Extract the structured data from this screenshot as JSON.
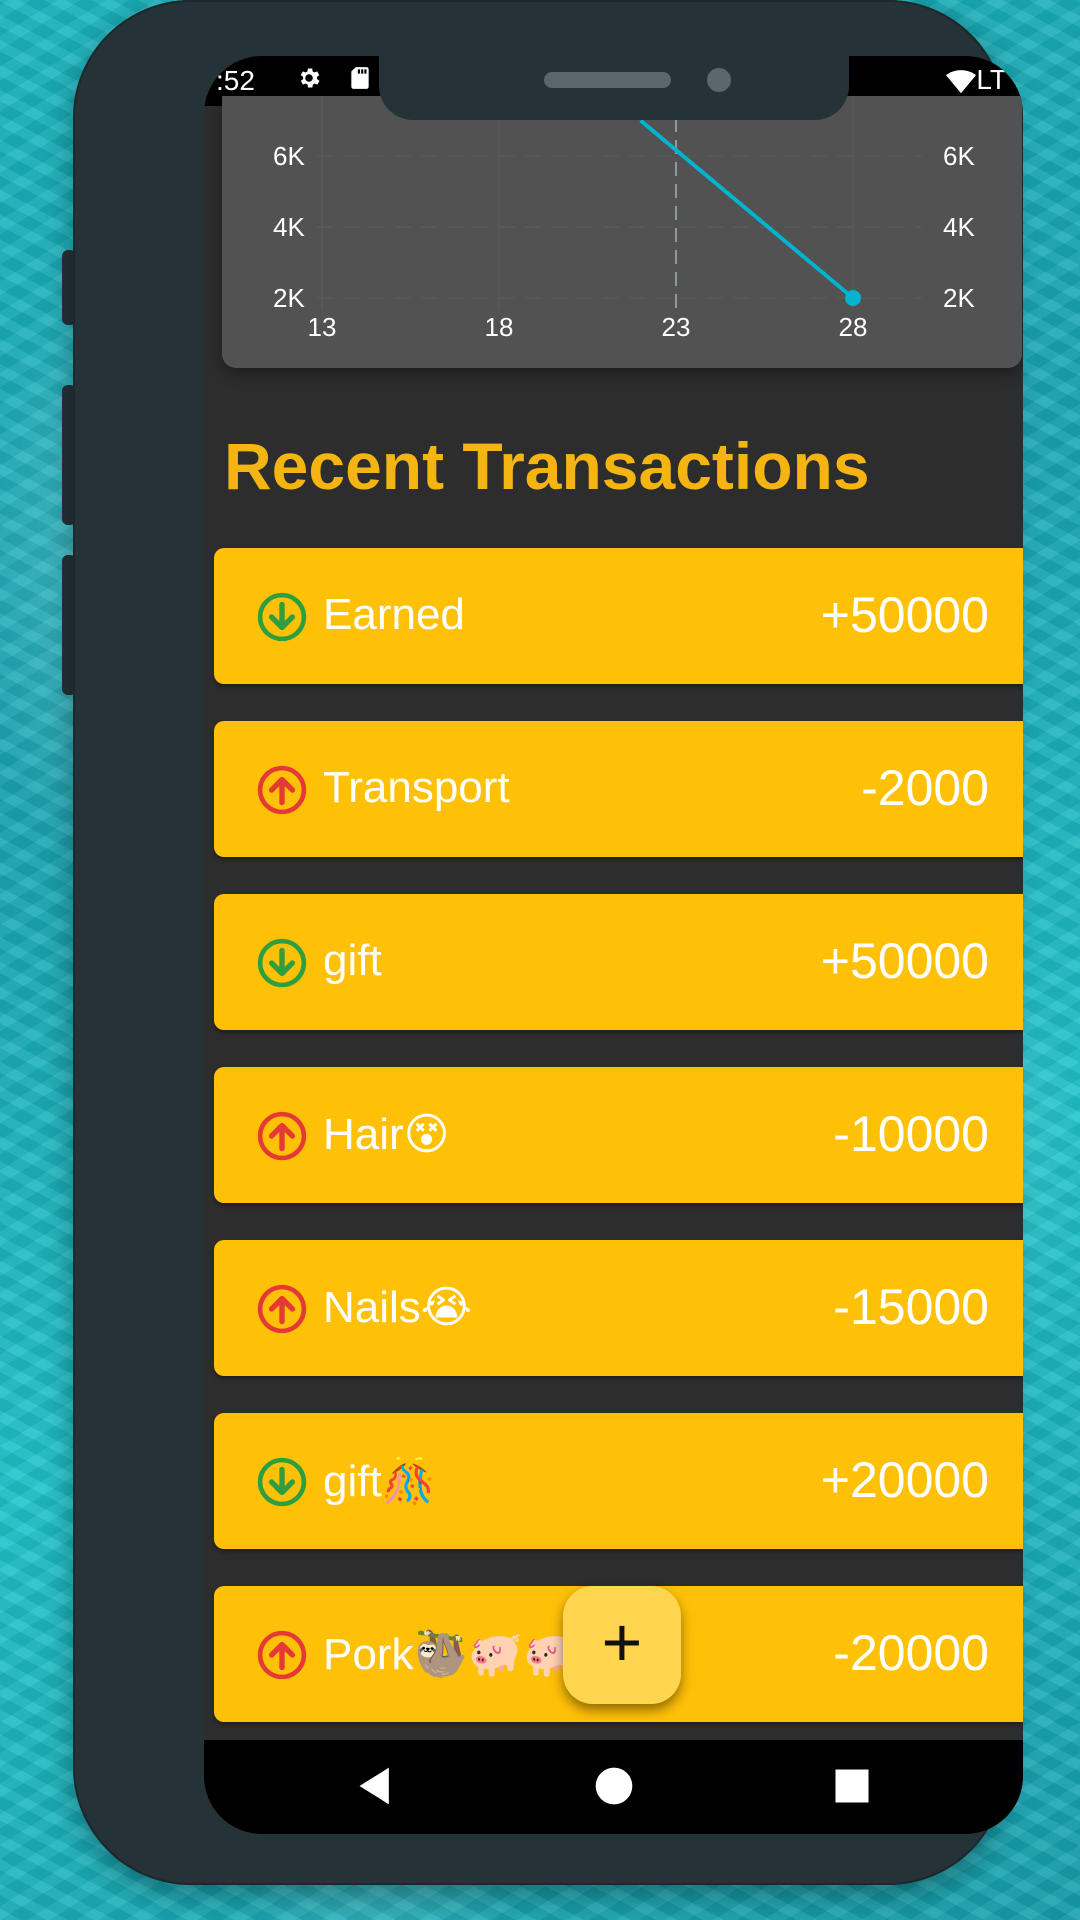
{
  "status_bar": {
    "time": ":52",
    "network": "LT"
  },
  "chart": {
    "y_ticks_left": [
      "6K",
      "4K",
      "2K"
    ],
    "y_ticks_right": [
      "6K",
      "4K",
      "2K"
    ],
    "x_ticks": [
      "13",
      "18",
      "23",
      "28"
    ],
    "line_color": "#00b3cf"
  },
  "chart_data": {
    "type": "line",
    "x": [
      22,
      28
    ],
    "series": [
      {
        "values": [
          7000,
          2000
        ]
      }
    ],
    "xlim": [
      11,
      30
    ],
    "ylim": [
      1500,
      6500
    ],
    "x_ticks": [
      13,
      18,
      23,
      28
    ],
    "y_ticks": [
      2000,
      4000,
      6000
    ],
    "grid": true
  },
  "section_title": "Recent Transactions",
  "transactions": [
    {
      "label": "Earned",
      "amount": "+50000",
      "type": "income"
    },
    {
      "label": "Transport",
      "amount": "-2000",
      "type": "expense"
    },
    {
      "label": "gift",
      "amount": "+50000",
      "type": "income"
    },
    {
      "label": "Hair😵",
      "amount": "-10000",
      "type": "expense"
    },
    {
      "label": "Nails😭",
      "amount": "-15000",
      "type": "expense"
    },
    {
      "label": "gift🎊",
      "amount": "+20000",
      "type": "income"
    },
    {
      "label": "Pork🦥🐖🐖",
      "amount": "-20000",
      "type": "expense"
    }
  ],
  "fab": {
    "label": "+"
  },
  "colors": {
    "accent": "#ffc107",
    "title": "#f4b512",
    "income_icon": "#2e9e3f",
    "expense_icon": "#e53935",
    "background": "#2d2d2d"
  }
}
